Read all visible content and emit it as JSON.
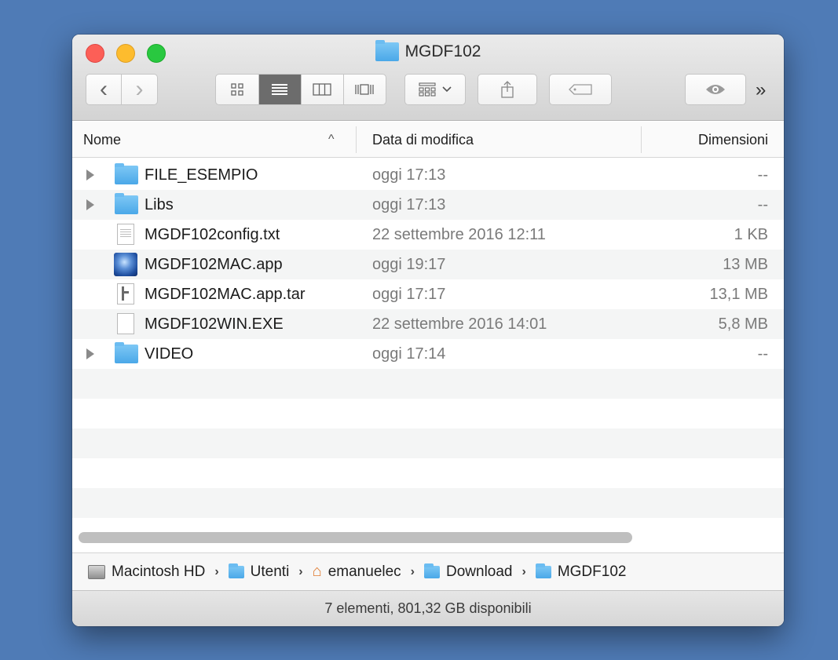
{
  "window": {
    "title": "MGDF102"
  },
  "toolbar": {
    "back_icon": "‹",
    "forward_icon": "›",
    "overflow_label": "»"
  },
  "columns": {
    "name": "Nome",
    "sort_indicator": "^",
    "date": "Data di modifica",
    "size": "Dimensioni"
  },
  "files": [
    {
      "name": "FILE_ESEMPIO",
      "date": "oggi 17:13",
      "size": "--",
      "kind": "folder"
    },
    {
      "name": "Libs",
      "date": "oggi 17:13",
      "size": "--",
      "kind": "folder"
    },
    {
      "name": "MGDF102config.txt",
      "date": "22 settembre 2016 12:11",
      "size": "1 KB",
      "kind": "text"
    },
    {
      "name": "MGDF102MAC.app",
      "date": "oggi 19:17",
      "size": "13 MB",
      "kind": "app"
    },
    {
      "name": "MGDF102MAC.app.tar",
      "date": "oggi 17:17",
      "size": "13,1 MB",
      "kind": "archive"
    },
    {
      "name": "MGDF102WIN.EXE",
      "date": "22 settembre 2016 14:01",
      "size": "5,8 MB",
      "kind": "document"
    },
    {
      "name": "VIDEO",
      "date": "oggi 17:14",
      "size": "--",
      "kind": "folder"
    }
  ],
  "path": {
    "items": [
      "Macintosh HD",
      "Utenti",
      "emanuelec",
      "Download",
      "MGDF102"
    ],
    "separator": "›"
  },
  "status": {
    "text": "7 elementi, 801,32 GB disponibili"
  }
}
